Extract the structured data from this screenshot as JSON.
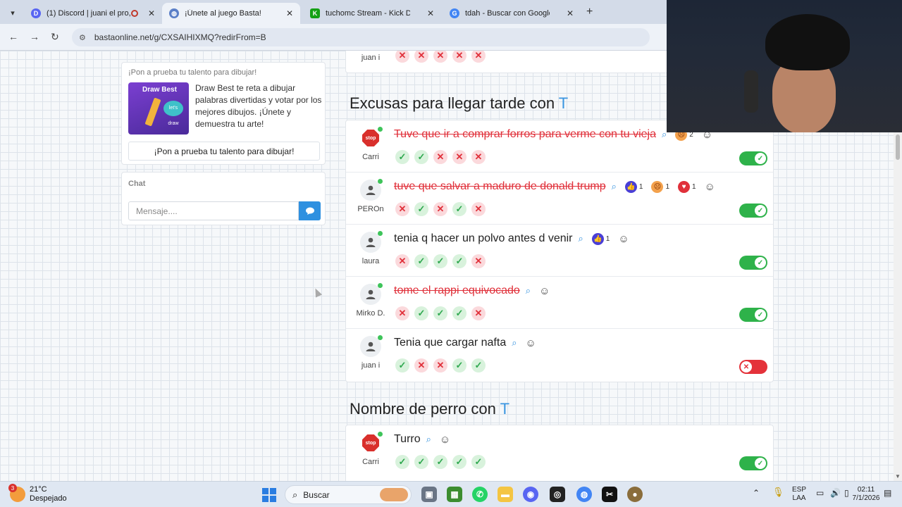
{
  "browser": {
    "tabs": [
      {
        "title": "(1) Discord | juani el pro, Lo",
        "icon": "discord-icon",
        "color": "#5865f2",
        "active": false
      },
      {
        "title": "¡Únete al juego Basta!",
        "icon": "globe-icon",
        "color": "#5b7fc7",
        "active": true
      },
      {
        "title": "tuchomc Stream - Kick Dashbo",
        "icon": "kick-icon",
        "color": "#53fc18",
        "active": false
      },
      {
        "title": "tdah - Buscar con Google",
        "icon": "google-icon",
        "color": "#4285f4",
        "active": false
      }
    ],
    "url": "bastaonline.net/g/CXSAIHIXMQ?redirFrom=B"
  },
  "sidebar": {
    "promo": {
      "heading": "¡Pon a prueba tu talento para dibujar!",
      "thumb_title": "Draw Best",
      "thumb_bubble": "let's draw",
      "description": "Draw Best te reta a dibujar palabras divertidas y votar por los mejores dibujos. ¡Únete y demuestra tu arte!",
      "button": "¡Pon a prueba tu talento para dibujar!"
    },
    "chat": {
      "heading": "Chat",
      "placeholder": "Mensaje...."
    }
  },
  "top_row": {
    "user": "juan i",
    "votes": [
      "no",
      "no",
      "no",
      "no",
      "no"
    ]
  },
  "sections": [
    {
      "title": "Excusas para llegar tarde con",
      "letter": "T",
      "rows": [
        {
          "user": "Carri",
          "avatar": "stop",
          "answer": "Tuve que ir a comprar forros para verme con tu vieja",
          "rejected": true,
          "reactions": [
            {
              "emoji": "angry",
              "count": "2"
            }
          ],
          "votes": [
            "ok",
            "ok",
            "no",
            "no",
            "no"
          ],
          "accepted": true
        },
        {
          "user": "PEROn",
          "avatar": "person",
          "answer": "tuve que salvar a maduro de donald trump",
          "rejected": true,
          "reactions": [
            {
              "emoji": "thumbs-up",
              "count": "1"
            },
            {
              "emoji": "angry",
              "count": "1"
            },
            {
              "emoji": "heart",
              "count": "1"
            }
          ],
          "votes": [
            "no",
            "ok",
            "no",
            "ok",
            "no"
          ],
          "accepted": true
        },
        {
          "user": "laura",
          "avatar": "person",
          "answer": "tenia q hacer un polvo antes d venir",
          "rejected": false,
          "reactions": [
            {
              "emoji": "thumbs-up",
              "count": "1"
            }
          ],
          "votes": [
            "no",
            "ok",
            "ok",
            "ok",
            "no"
          ],
          "accepted": true
        },
        {
          "user": "Mirko D.",
          "avatar": "person-star",
          "answer": "tome el rappi equivocado",
          "rejected": true,
          "reactions": [],
          "votes": [
            "no",
            "ok",
            "ok",
            "ok",
            "no"
          ],
          "accepted": true
        },
        {
          "user": "juan i",
          "avatar": "person",
          "answer": "Tenia que cargar nafta",
          "rejected": false,
          "reactions": [],
          "votes": [
            "ok",
            "no",
            "no",
            "ok",
            "ok"
          ],
          "accepted": false
        }
      ]
    },
    {
      "title": "Nombre de perro con",
      "letter": "T",
      "rows": [
        {
          "user": "Carri",
          "avatar": "stop",
          "answer": "Turro",
          "rejected": false,
          "reactions": [],
          "votes": [
            "ok",
            "ok",
            "ok",
            "ok",
            "ok"
          ],
          "accepted": true
        }
      ]
    }
  ],
  "stop_label": "stop",
  "taskbar": {
    "weather_temp": "21°C",
    "weather_desc": "Despejado",
    "weather_badge": "3",
    "search_label": "Buscar",
    "lang_1": "ESP",
    "lang_2": "LAA",
    "time": "02:11",
    "date": "7/1/2026"
  },
  "colors": {
    "accent": "#3a95e0",
    "ok": "#2eb24a",
    "error": "#e0303a"
  }
}
